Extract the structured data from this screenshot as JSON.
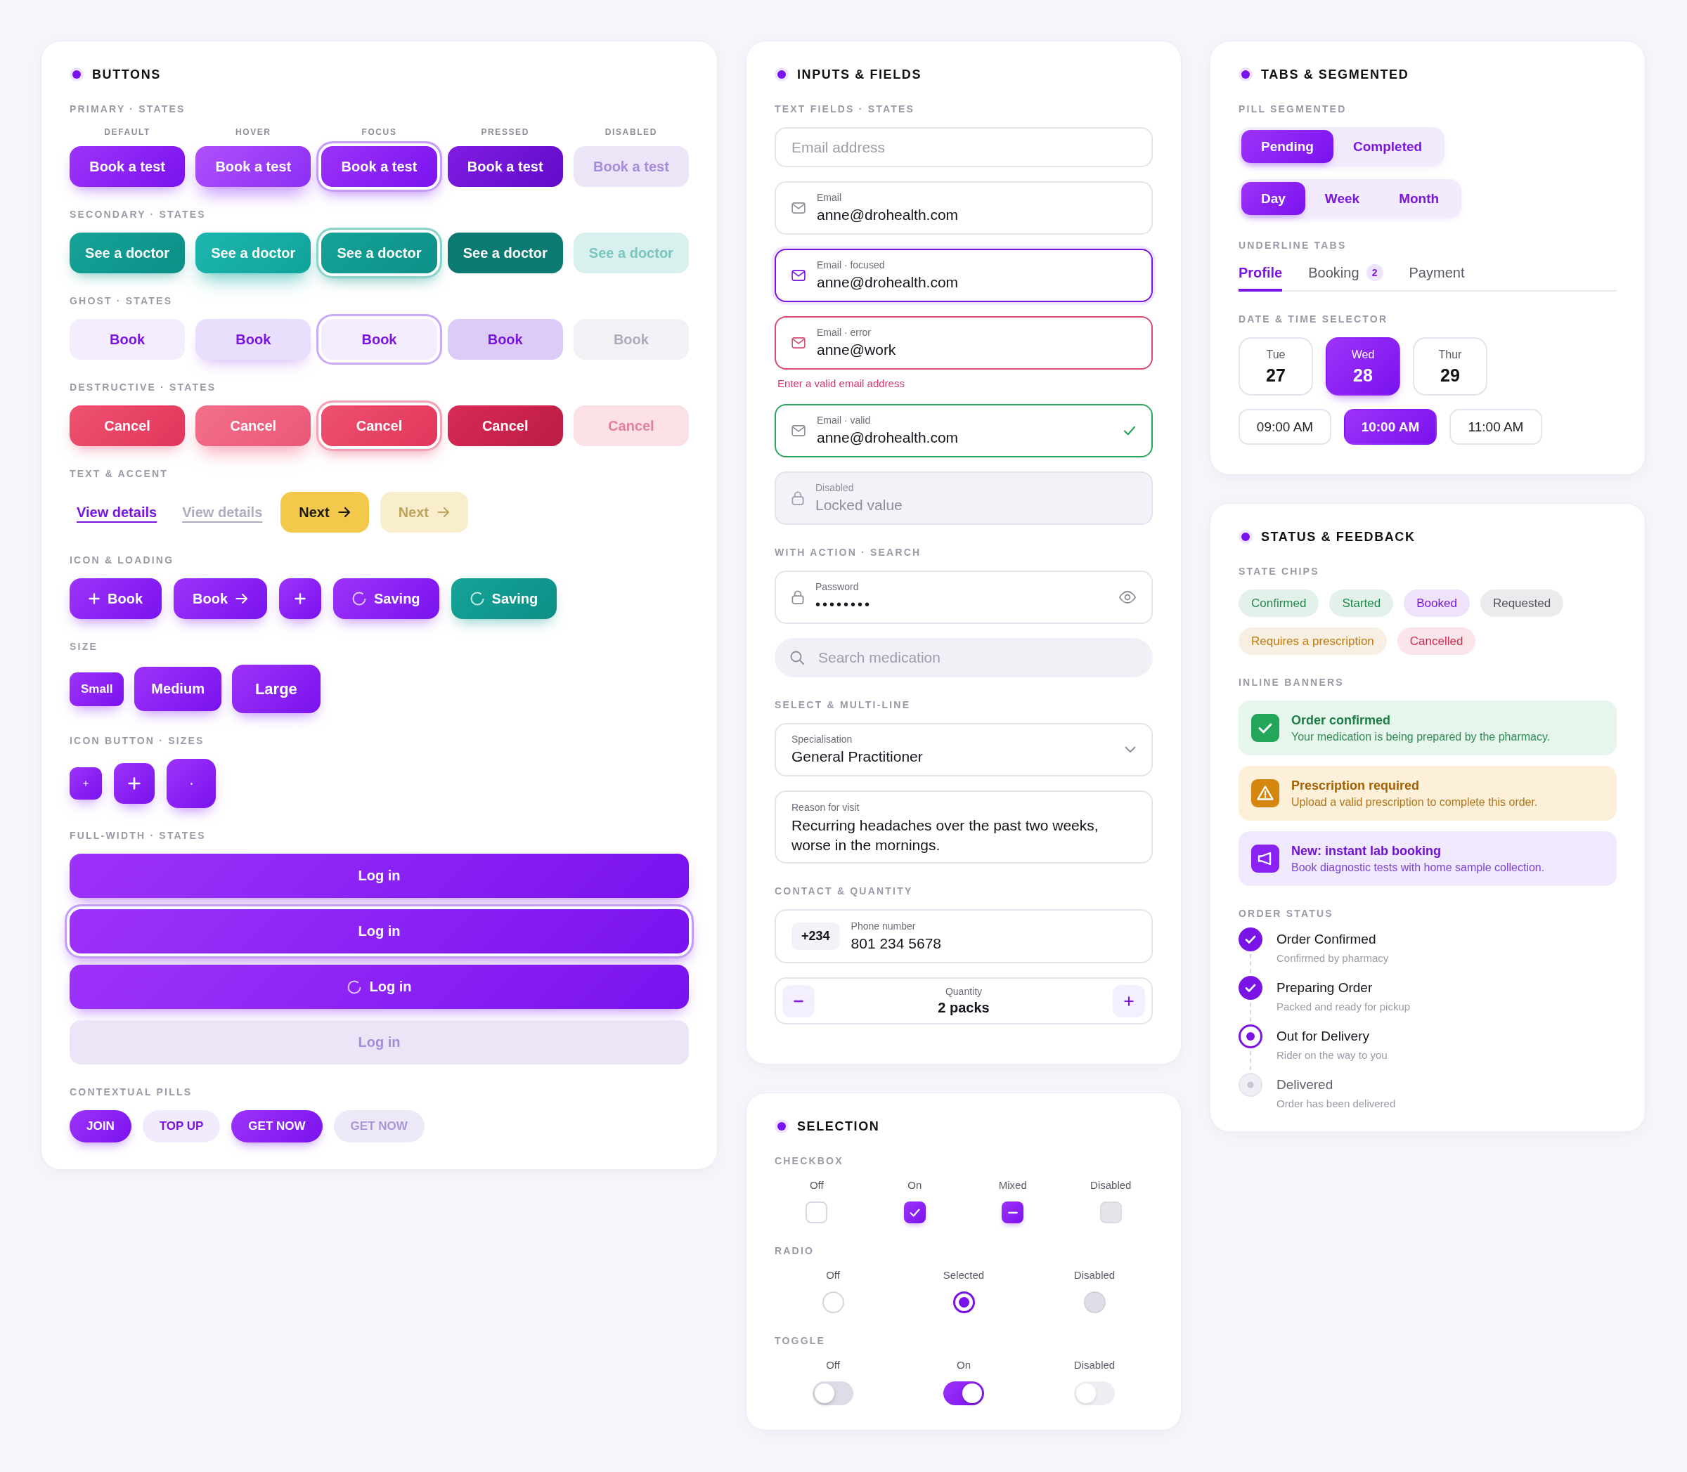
{
  "buttons_card": {
    "title": "BUTTONS",
    "state_rows": [
      {
        "heading": "PRIMARY · STATES",
        "kind": "primary",
        "columns": [
          "DEFAULT",
          "HOVER",
          "FOCUS",
          "PRESSED",
          "DISABLED"
        ],
        "buttons": [
          {
            "label": "Book a test",
            "hovered": false,
            "focused": false,
            "pressed": false,
            "disabled": false
          },
          {
            "label": "Book a test",
            "hovered": true,
            "focused": false,
            "pressed": false,
            "disabled": false
          },
          {
            "label": "Book a test",
            "hovered": false,
            "focused": true,
            "pressed": false,
            "disabled": false
          },
          {
            "label": "Book a test",
            "hovered": false,
            "focused": false,
            "pressed": true,
            "disabled": false
          },
          {
            "label": "Book a test",
            "hovered": false,
            "focused": false,
            "pressed": false,
            "disabled": true
          }
        ]
      },
      {
        "heading": "SECONDARY · STATES",
        "kind": "secondary",
        "buttons": [
          {
            "label": "See a doctor",
            "hovered": false,
            "focused": false,
            "pressed": false,
            "disabled": false
          },
          {
            "label": "See a doctor",
            "hovered": true,
            "focused": false,
            "pressed": false,
            "disabled": false
          },
          {
            "label": "See a doctor",
            "hovered": false,
            "focused": true,
            "pressed": false,
            "disabled": false
          },
          {
            "label": "See a doctor",
            "hovered": false,
            "focused": false,
            "pressed": true,
            "disabled": false
          },
          {
            "label": "See a doctor",
            "hovered": false,
            "focused": false,
            "pressed": false,
            "disabled": true
          }
        ]
      },
      {
        "heading": "GHOST · STATES",
        "kind": "ghost",
        "buttons": [
          {
            "label": "Book",
            "hovered": false,
            "focused": false,
            "pressed": false,
            "disabled": false
          },
          {
            "label": "Book",
            "hovered": true,
            "focused": false,
            "pressed": false,
            "disabled": false
          },
          {
            "label": "Book",
            "hovered": false,
            "focused": true,
            "pressed": false,
            "disabled": false
          },
          {
            "label": "Book",
            "hovered": false,
            "focused": false,
            "pressed": true,
            "disabled": false
          },
          {
            "label": "Book",
            "hovered": false,
            "focused": false,
            "pressed": false,
            "disabled": true
          }
        ]
      },
      {
        "heading": "DESTRUCTIVE · STATES",
        "kind": "destructive",
        "buttons": [
          {
            "label": "Cancel",
            "hovered": false,
            "focused": false,
            "pressed": false,
            "disabled": false
          },
          {
            "label": "Cancel",
            "hovered": true,
            "focused": false,
            "pressed": false,
            "disabled": false
          },
          {
            "label": "Cancel",
            "hovered": false,
            "focused": true,
            "pressed": false,
            "disabled": false
          },
          {
            "label": "Cancel",
            "hovered": false,
            "focused": false,
            "pressed": true,
            "disabled": false
          },
          {
            "label": "Cancel",
            "hovered": false,
            "focused": false,
            "pressed": false,
            "disabled": true
          }
        ]
      }
    ],
    "text_accent": {
      "heading": "TEXT & ACCENT",
      "items": [
        {
          "kind": "link",
          "label": "View details",
          "disabled": false
        },
        {
          "kind": "link",
          "label": "View details",
          "disabled": true
        },
        {
          "kind": "accent",
          "label": "Next",
          "disabled": false
        },
        {
          "kind": "accent",
          "label": "Next",
          "disabled": true
        }
      ]
    },
    "icon_loading": {
      "heading": "ICON & LOADING",
      "items": [
        {
          "kind": "leading",
          "label": "Book"
        },
        {
          "kind": "trailing",
          "label": "Book"
        },
        {
          "kind": "square"
        },
        {
          "kind": "loading",
          "label": "Saving"
        },
        {
          "kind": "secondary",
          "label": "Saving"
        }
      ]
    },
    "sizes": {
      "heading": "SIZE",
      "items": [
        {
          "label": "Small",
          "kind": "small"
        },
        {
          "label": "Medium",
          "kind": "medium"
        },
        {
          "label": "Large",
          "kind": "large"
        }
      ]
    },
    "icon_sizes": {
      "heading": "ICON BUTTON · SIZES",
      "items": [
        {
          "kind": "small"
        },
        {
          "kind": "medium"
        },
        {
          "kind": "large"
        }
      ]
    },
    "full_width": {
      "heading": "FULL-WIDTH · STATES",
      "buttons": [
        {
          "label": "Log in",
          "focused": false,
          "loading": false,
          "disabled": false
        },
        {
          "label": "Log in",
          "focused": true,
          "loading": false,
          "disabled": false
        },
        {
          "label": "Log in",
          "focused": false,
          "loading": true,
          "disabled": false
        },
        {
          "label": "Log in",
          "focused": false,
          "loading": false,
          "disabled": true
        }
      ]
    },
    "pills": {
      "heading": "CONTEXTUAL PILLS",
      "items": [
        {
          "label": "JOIN",
          "kind": "solid",
          "disabled": false
        },
        {
          "label": "TOP UP",
          "kind": "soft",
          "disabled": false
        },
        {
          "label": "GET NOW",
          "kind": "solid",
          "disabled": false
        },
        {
          "label": "GET NOW",
          "kind": "solid",
          "disabled": true
        }
      ]
    }
  },
  "inputs_card": {
    "title": "INPUTS & FIELDS",
    "text_fields": {
      "heading": "TEXT FIELDS · STATES",
      "fields": [
        {
          "kind": "plain",
          "placeholder": "Email address",
          "focused": false,
          "error": false,
          "valid": false,
          "disabled": false
        },
        {
          "kind": "email",
          "label": "Email",
          "value": "anne@drohealth.com",
          "focused": false,
          "error": false,
          "valid": false,
          "disabled": false
        },
        {
          "kind": "email",
          "label": "Email · focused",
          "value": "anne@drohealth.com",
          "focused": true,
          "error": false,
          "valid": false,
          "disabled": false
        },
        {
          "kind": "email",
          "label": "Email · error",
          "value": "anne@work",
          "message": "Enter a valid email address",
          "focused": false,
          "error": true,
          "valid": false,
          "disabled": false
        },
        {
          "kind": "email",
          "label": "Email · valid",
          "value": "anne@drohealth.com",
          "focused": false,
          "error": false,
          "valid": true,
          "disabled": false
        },
        {
          "kind": "locked",
          "label": "Disabled",
          "value": "Locked value",
          "focused": false,
          "error": false,
          "valid": false,
          "disabled": true
        }
      ]
    },
    "with_action": {
      "heading": "WITH ACTION · SEARCH",
      "password": {
        "label": "Password",
        "value": "••••••••"
      },
      "search": {
        "placeholder": "Search medication"
      }
    },
    "select_multiline": {
      "heading": "SELECT & MULTI-LINE",
      "select": {
        "label": "Specialisation",
        "value": "General Practitioner"
      },
      "textarea": {
        "label": "Reason for visit",
        "value": "Recurring headaches over the past two weeks, worse in the mornings."
      }
    },
    "contact_quantity": {
      "heading": "CONTACT & QUANTITY",
      "phone": {
        "code": "+234",
        "label": "Phone number",
        "value": "801 234 5678"
      },
      "quantity": {
        "label": "Quantity",
        "value": "2 packs"
      }
    }
  },
  "selection_card": {
    "title": "SELECTION",
    "checkbox": {
      "heading": "CHECKBOX",
      "items": [
        {
          "label": "Off",
          "kind": "check",
          "checked": false,
          "disabled": false
        },
        {
          "label": "On",
          "kind": "check",
          "checked": true,
          "disabled": false
        },
        {
          "label": "Mixed",
          "kind": "mixed",
          "checked": true,
          "disabled": false
        },
        {
          "label": "Disabled",
          "kind": "check",
          "checked": false,
          "disabled": true
        }
      ]
    },
    "radio": {
      "heading": "RADIO",
      "items": [
        {
          "label": "Off",
          "selected": false,
          "disabled": false
        },
        {
          "label": "Selected",
          "selected": true,
          "disabled": false
        },
        {
          "label": "Disabled",
          "selected": false,
          "disabled": true
        }
      ]
    },
    "toggle": {
      "heading": "TOGGLE",
      "items": [
        {
          "label": "Off",
          "on": false,
          "disabled": false
        },
        {
          "label": "On",
          "on": true,
          "disabled": false
        },
        {
          "label": "Disabled",
          "on": false,
          "disabled": true
        }
      ]
    }
  },
  "tabs_card": {
    "title": "TABS & SEGMENTED",
    "pill_segmented": {
      "heading": "PILL SEGMENTED",
      "groups": [
        {
          "options": [
            {
              "label": "Pending",
              "selected": true
            },
            {
              "label": "Completed",
              "selected": false
            }
          ]
        },
        {
          "options": [
            {
              "label": "Day",
              "selected": true
            },
            {
              "label": "Week",
              "selected": false
            },
            {
              "label": "Month",
              "selected": false
            }
          ]
        }
      ]
    },
    "underline_tabs": {
      "heading": "UNDERLINE TABS",
      "tabs": [
        {
          "label": "Profile",
          "selected": true
        },
        {
          "label": "Booking",
          "badge": "2",
          "selected": false
        },
        {
          "label": "Payment",
          "selected": false
        }
      ]
    },
    "date_time": {
      "heading": "DATE & TIME SELECTOR",
      "dates": [
        {
          "day": "Tue",
          "date": "27",
          "selected": false
        },
        {
          "day": "Wed",
          "date": "28",
          "selected": true
        },
        {
          "day": "Thur",
          "date": "29",
          "selected": false
        }
      ],
      "times": [
        {
          "label": "09:00 AM",
          "selected": false
        },
        {
          "label": "10:00 AM",
          "selected": true
        },
        {
          "label": "11:00 AM",
          "selected": false
        }
      ]
    }
  },
  "status_card": {
    "title": "STATUS & FEEDBACK",
    "state_chips": {
      "heading": "STATE CHIPS",
      "chips": [
        {
          "label": "Confirmed",
          "color": "#1e8a4c"
        },
        {
          "label": "Started",
          "color": "#1e8a4c"
        },
        {
          "label": "Booked",
          "color": "#7a14e0"
        },
        {
          "label": "Requested",
          "color": "#55535f"
        },
        {
          "label": "Requires a prescription",
          "color": "#c07a0e"
        },
        {
          "label": "Cancelled",
          "color": "#cf2a4f"
        }
      ]
    },
    "inline_banners": {
      "heading": "INLINE BANNERS",
      "banners": [
        {
          "kind": "success",
          "title": "Order confirmed",
          "message": "Your medication is being prepared by the pharmacy."
        },
        {
          "kind": "warning",
          "title": "Prescription required",
          "message": "Upload a valid prescription to complete this order."
        },
        {
          "kind": "promo",
          "title": "New: instant lab booking",
          "message": "Book diagnostic tests with home sample collection."
        }
      ]
    },
    "order_status": {
      "heading": "ORDER STATUS",
      "steps": [
        {
          "title": "Order Confirmed",
          "subtitle": "Confirmed by pharmacy",
          "done": true,
          "current": false
        },
        {
          "title": "Preparing Order",
          "subtitle": "Packed and ready for pickup",
          "done": true,
          "current": false
        },
        {
          "title": "Out for Delivery",
          "subtitle": "Rider on the way to you",
          "done": false,
          "current": true
        },
        {
          "title": "Delivered",
          "subtitle": "Order has been delivered",
          "done": false,
          "current": false
        }
      ]
    }
  }
}
